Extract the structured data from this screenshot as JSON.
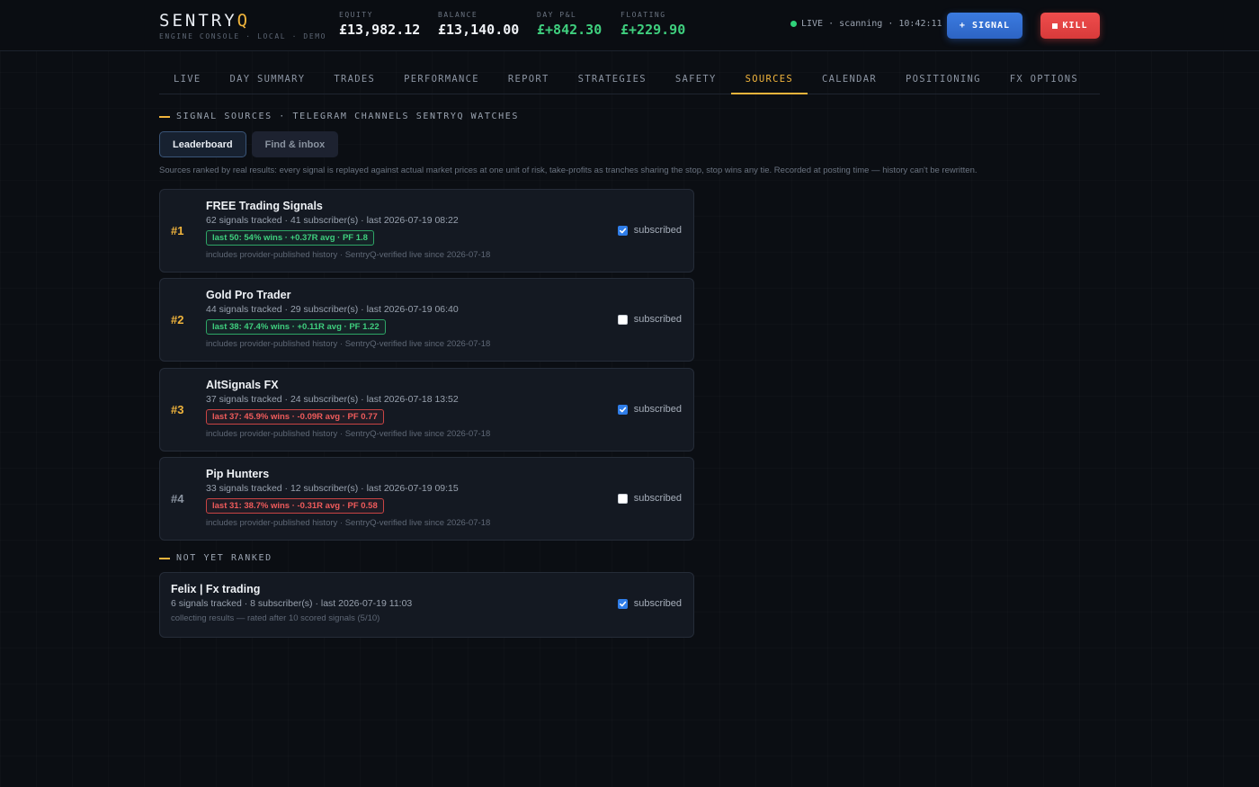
{
  "brand": {
    "name_main": "SENTRY",
    "name_accent": "Q",
    "subtitle": "ENGINE CONSOLE · LOCAL · DEMO"
  },
  "stats": [
    {
      "label": "EQUITY",
      "value": "£13,982.12",
      "color": "#f0f3f7"
    },
    {
      "label": "BALANCE",
      "value": "£13,140.00",
      "color": "#f0f3f7"
    },
    {
      "label": "DAY P&L",
      "value": "£+842.30",
      "color": "#3fcf7e"
    },
    {
      "label": "FLOATING",
      "value": "£+229.90",
      "color": "#3fcf7e"
    }
  ],
  "status": {
    "text": "LIVE · scanning · 10:42:11",
    "dot_color": "#2fd27a"
  },
  "actions": {
    "signal_label": "+ SIGNAL",
    "kill_label": "KILL"
  },
  "tabs": [
    {
      "label": "LIVE"
    },
    {
      "label": "DAY SUMMARY"
    },
    {
      "label": "TRADES"
    },
    {
      "label": "PERFORMANCE"
    },
    {
      "label": "REPORT"
    },
    {
      "label": "STRATEGIES"
    },
    {
      "label": "SAFETY"
    },
    {
      "label": "SOURCES",
      "active": true
    },
    {
      "label": "CALENDAR"
    },
    {
      "label": "POSITIONING"
    },
    {
      "label": "FX OPTIONS"
    }
  ],
  "section": {
    "title": "SIGNAL SOURCES · TELEGRAM CHANNELS SENTRYQ WATCHES",
    "subtabs": {
      "leaderboard": "Leaderboard",
      "find_inbox": "Find & inbox"
    },
    "description": "Sources ranked by real results: every signal is replayed against actual market prices at one unit of risk, take-profits as tranches sharing the stop, stop wins any tie. Recorded at posting time — history can't be rewritten."
  },
  "subscribed_label": "subscribed",
  "sources": [
    {
      "rank": "#1",
      "name": "FREE Trading Signals",
      "meta": "62 signals tracked · 41 subscriber(s) · last 2026-07-19 08:22",
      "badge": "last 50: 54% wins · +0.37R avg · PF 1.8",
      "badge_tone": "green",
      "note": "includes provider-published history · SentryQ-verified live since 2026-07-18",
      "subscribed": true
    },
    {
      "rank": "#2",
      "name": "Gold Pro Trader",
      "meta": "44 signals tracked · 29 subscriber(s) · last 2026-07-19 06:40",
      "badge": "last 38: 47.4% wins · +0.11R avg · PF 1.22",
      "badge_tone": "green",
      "note": "includes provider-published history · SentryQ-verified live since 2026-07-18",
      "subscribed": false
    },
    {
      "rank": "#3",
      "name": "AltSignals FX",
      "meta": "37 signals tracked · 24 subscriber(s) · last 2026-07-18 13:52",
      "badge": "last 37: 45.9% wins · -0.09R avg · PF 0.77",
      "badge_tone": "red",
      "note": "includes provider-published history · SentryQ-verified live since 2026-07-18",
      "subscribed": true
    },
    {
      "rank": "#4",
      "name": "Pip Hunters",
      "meta": "33 signals tracked · 12 subscriber(s) · last 2026-07-19 09:15",
      "badge": "last 31: 38.7% wins · -0.31R avg · PF 0.58",
      "badge_tone": "red",
      "note": "includes provider-published history · SentryQ-verified live since 2026-07-18",
      "subscribed": false
    }
  ],
  "unranked": {
    "title": "NOT YET RANKED",
    "items": [
      {
        "name": "Felix | Fx trading",
        "meta": "6 signals tracked · 8 subscriber(s) · last 2026-07-19 11:03",
        "note": "collecting results — rated after 10 scored signals (5/10)",
        "subscribed": true
      }
    ]
  },
  "colors": {
    "accent": "#f0b43c",
    "positive": "#3fcf7e",
    "negative": "#ef5b5b",
    "primary": "#3b7be0",
    "danger": "#ef4d4d"
  }
}
